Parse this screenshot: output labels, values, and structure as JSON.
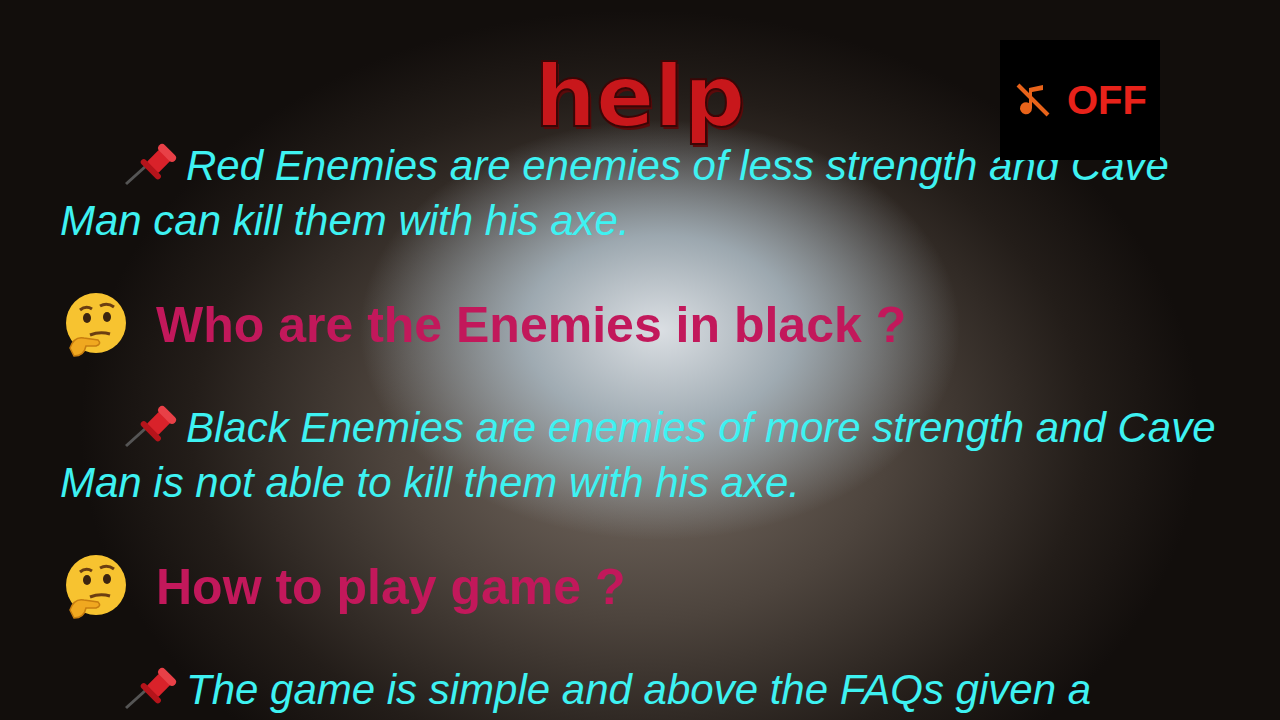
{
  "title": "help",
  "music": {
    "label": "OFF",
    "on": false
  },
  "faq": [
    {
      "kind": "answer",
      "text": "Red Enemies are enemies of less strength and Cave Man can kill them with his axe."
    },
    {
      "kind": "question",
      "text": "Who are the Enemies in black ?"
    },
    {
      "kind": "answer",
      "text": "Black Enemies are enemies of more strength and Cave Man is not able to kill them with his axe."
    },
    {
      "kind": "question",
      "text": "How to play game ?"
    },
    {
      "kind": "answer",
      "text": "The game is simple and above the FAQs given a"
    }
  ]
}
